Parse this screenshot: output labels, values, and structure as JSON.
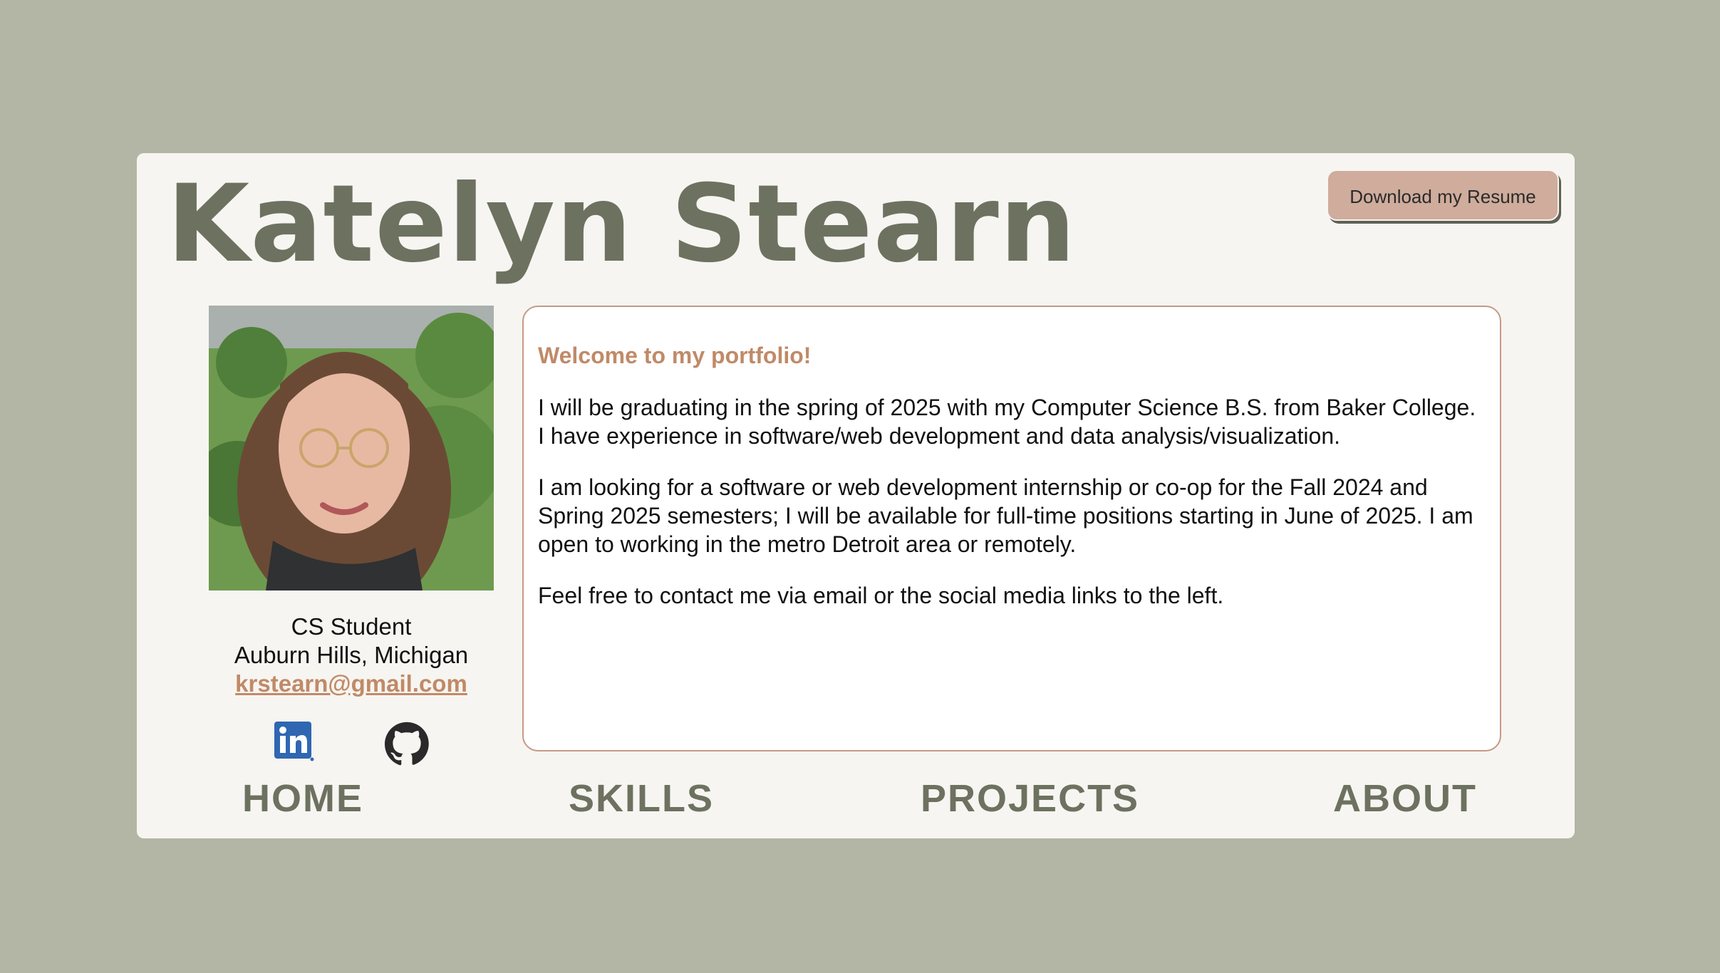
{
  "header": {
    "name": "Katelyn Stearn",
    "resume_button": "Download my Resume"
  },
  "profile": {
    "role": "CS Student",
    "location": "Auburn Hills, Michigan",
    "email": "krstearn@gmail.com",
    "social": {
      "linkedin_icon": "linkedin-icon",
      "github_icon": "github-icon"
    }
  },
  "intro": {
    "welcome": "Welcome to my portfolio!",
    "paragraphs": [
      "I will be graduating in the spring of 2025 with my Computer Science B.S. from Baker College. I have experience in software/web development and data analysis/visualization.",
      "I am looking for a software or web development internship or co-op for the Fall 2024 and Spring 2025 semesters; I will be available for full-time positions starting in June of 2025. I am open to working in the metro Detroit area or remotely.",
      "Feel free to contact me via email or the social media links to the left."
    ]
  },
  "nav": {
    "home": "HOME",
    "skills": "SKILLS",
    "projects": "PROJECTS",
    "about": "ABOUT"
  },
  "colors": {
    "page_background": "#b4b6a5",
    "card_background": "#f7f5f1",
    "heading": "#6d7260",
    "accent": "#c08a68",
    "button": "#cfac9c",
    "linkedin": "#2f67b2",
    "github": "#2a2a2a"
  }
}
